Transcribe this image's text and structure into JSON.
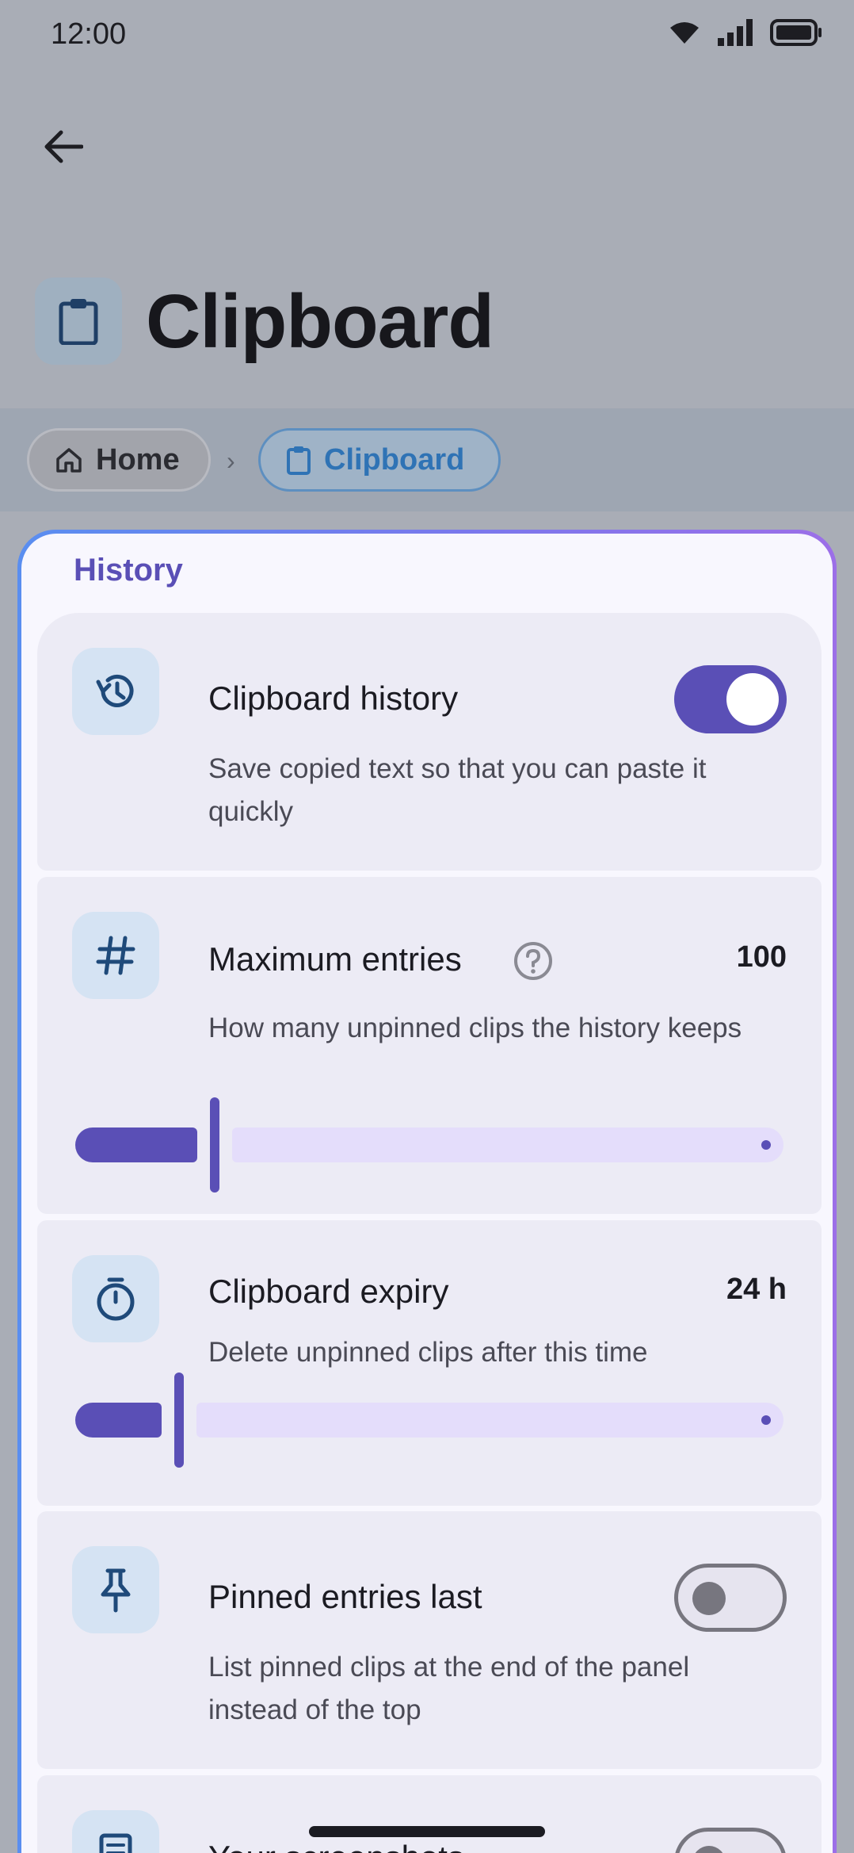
{
  "status_bar": {
    "time": "12:00"
  },
  "header": {
    "title": "Clipboard"
  },
  "breadcrumb": {
    "items": [
      {
        "label": "Home"
      },
      {
        "label": "Clipboard"
      }
    ],
    "separator": "›"
  },
  "section": {
    "title": "History"
  },
  "settings": {
    "clipboard_history": {
      "title": "Clipboard history",
      "description": "Save copied text so that you can paste it quickly",
      "enabled": true
    },
    "max_entries": {
      "title": "Maximum entries",
      "description": "How many unpinned clips the history keeps",
      "value": "100",
      "slider_fraction": 0.19
    },
    "expiry": {
      "title": "Clipboard expiry",
      "description": "Delete unpinned clips after this time",
      "value": "24 h",
      "slider_fraction": 0.14
    },
    "pinned_last": {
      "title": "Pinned entries last",
      "description": "List pinned clips at the end of the panel instead of the top",
      "enabled": false
    },
    "screenshots": {
      "title": "Your screenshots",
      "enabled": false
    }
  },
  "colors": {
    "accent": "#5a4fb6",
    "link_blue": "#2f73b5",
    "panel_border_start": "#5a8ef0",
    "panel_border_end": "#9c6fe8"
  },
  "icons": {
    "back": "arrow-left-icon",
    "app": "clipboard-icon",
    "home": "home-icon",
    "history": "history-icon",
    "max_entries": "hash-icon",
    "expiry": "timer-icon",
    "pinned": "pin-icon",
    "help": "help-circle-icon",
    "screenshots": "document-icon"
  }
}
